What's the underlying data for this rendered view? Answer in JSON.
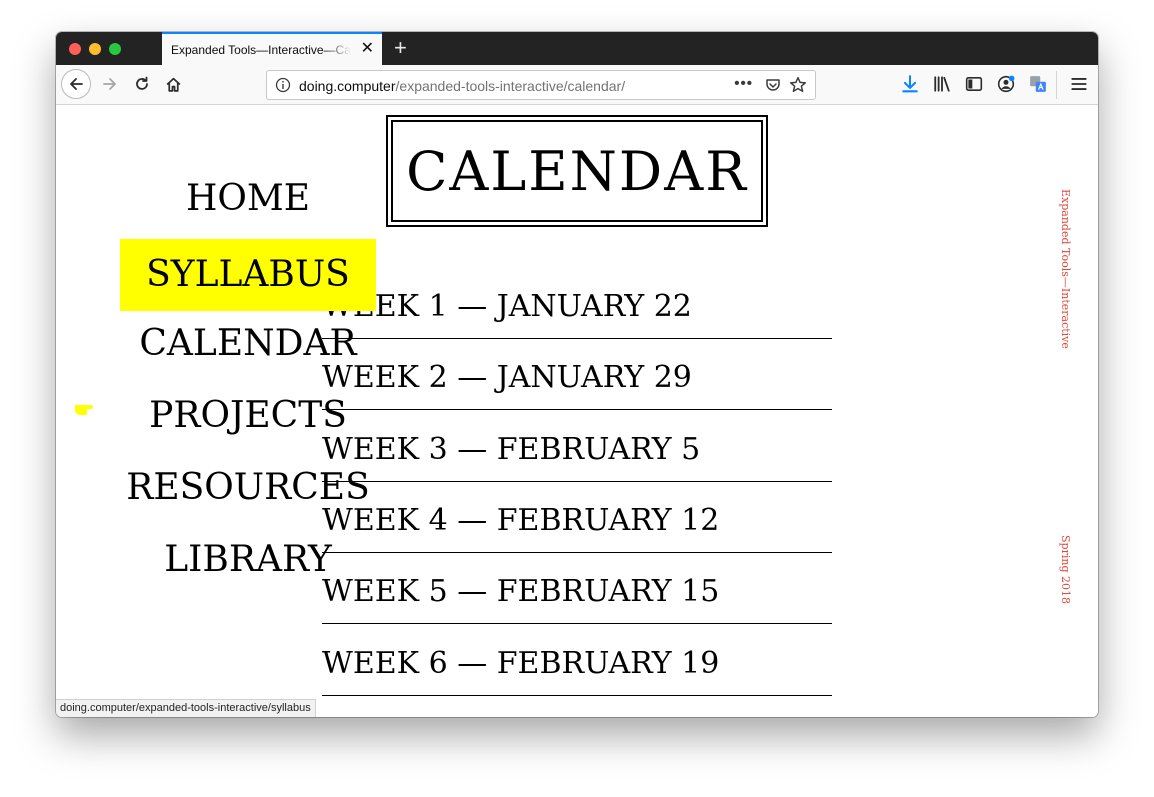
{
  "browser": {
    "tab_title": "Expanded Tools—Interactive—Calendar",
    "new_tab_label": "+",
    "close_label": "✕",
    "url_domain": "doing.computer",
    "url_path": "/expanded-tools-interactive/calendar/",
    "url_more": "•••",
    "status_url": "doing.computer/expanded-tools-interactive/syllabus",
    "accent_color": "#0a84ff"
  },
  "page": {
    "title": "CALENDAR",
    "nav": [
      {
        "label": "HOME"
      },
      {
        "label": "SYLLABUS"
      },
      {
        "label": "CALENDAR"
      },
      {
        "label": "PROJECTS"
      },
      {
        "label": "RESOURCES"
      },
      {
        "label": "LIBRARY"
      }
    ],
    "weeks": [
      {
        "label": "WEEK 1 — JANUARY 22"
      },
      {
        "label": "WEEK 2 — JANUARY 29"
      },
      {
        "label": "WEEK 3 — FEBRUARY 5"
      },
      {
        "label": "WEEK 4 — FEBRUARY 12"
      },
      {
        "label": "WEEK 5 — FEBRUARY 15"
      },
      {
        "label": "WEEK 6 — FEBRUARY 19"
      }
    ],
    "side_course": "Expanded Tools—Interactive",
    "side_term": "Spring 2018",
    "highlight_color": "#ffff00",
    "side_color": "#e04a3f"
  }
}
